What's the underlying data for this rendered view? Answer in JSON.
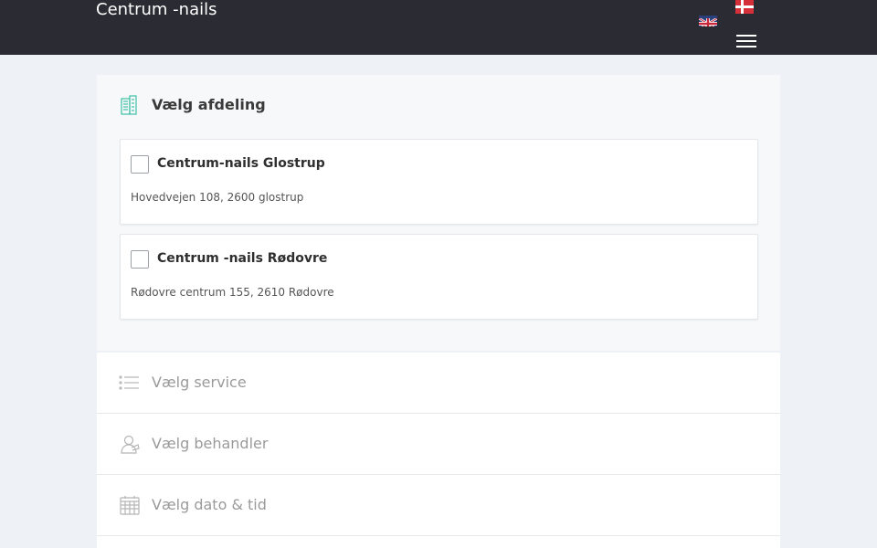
{
  "header": {
    "brand": "Centrum -nails",
    "languages": [
      "english-flag",
      "danish-flag"
    ],
    "menu_icon": "hamburger-icon"
  },
  "department": {
    "title": "Vælg afdeling",
    "icon": "building-icon",
    "options": [
      {
        "name": "Centrum-nails Glostrup",
        "address": "Hovedvejen 108, 2600 glostrup",
        "checked": false
      },
      {
        "name": "Centrum -nails Rødovre",
        "address": "Rødovre centrum 155, 2610 Rødovre",
        "checked": false
      }
    ]
  },
  "steps": [
    {
      "label": "Vælg service",
      "icon": "list-icon"
    },
    {
      "label": "Vælg behandler",
      "icon": "person-icon"
    },
    {
      "label": "Vælg dato & tid",
      "icon": "calendar-icon"
    }
  ],
  "colors": {
    "header_bg": "#2b2b33",
    "accent": "#3dbfa5",
    "muted_text": "#9a9a9a"
  }
}
